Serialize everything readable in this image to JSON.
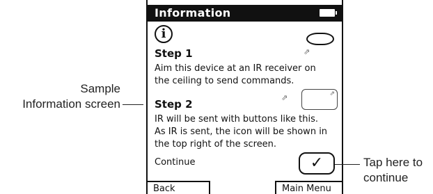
{
  "screen": {
    "title": "Information",
    "info_symbol": "i",
    "step1": {
      "title": "Step 1",
      "line1": "Aim this device at an IR receiver on",
      "line2": "the ceiling to send commands."
    },
    "step2": {
      "title": "Step 2",
      "line1": "IR will be sent with buttons like this.",
      "line2": "As IR is sent, the icon will be shown in",
      "line3": "the top right of the screen."
    },
    "continue_label": "Continue",
    "checkmark": "✓",
    "buttons": {
      "back": "Back",
      "main_menu": "Main Menu"
    }
  },
  "callouts": {
    "left_line1": "Sample",
    "left_line2": "Information screen",
    "right_line1": "Tap here to",
    "right_line2": "continue"
  },
  "icons": [
    "info-icon",
    "battery-icon",
    "ir-receiver-icon",
    "ir-waves-icon",
    "ir-button-icon",
    "checkmark-icon"
  ]
}
